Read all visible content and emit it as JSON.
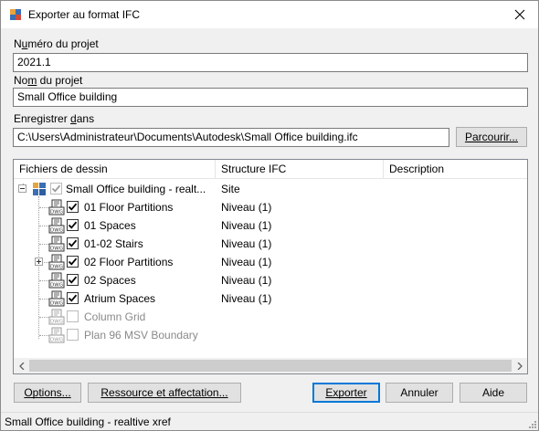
{
  "window": {
    "title": "Exporter au format IFC",
    "close_icon": "close-icon"
  },
  "project_number": {
    "label_prefix": "N",
    "label_underlined": "u",
    "label_rest": "méro du projet",
    "value": "2021.1"
  },
  "project_name": {
    "label_prefix": "No",
    "label_underlined": "m",
    "label_rest": " du projet",
    "value": "Small Office building"
  },
  "save_in": {
    "label_prefix": "Enregistrer ",
    "label_underlined": "d",
    "label_rest": "ans",
    "value": "C:\\Users\\Administrateur\\Documents\\Autodesk\\Small Office building.ifc",
    "browse_label": "Parcourir..."
  },
  "list": {
    "columns": [
      "Fichiers de dessin",
      "Structure IFC",
      "Description"
    ],
    "rows": [
      {
        "name": "Small Office building - realt...",
        "structure": "Site",
        "checked": true,
        "enabled": true,
        "icon": "project-icon"
      },
      {
        "name": "01 Floor Partitions",
        "structure": "Niveau (1)",
        "checked": true,
        "enabled": true,
        "icon": "dwg-file-icon"
      },
      {
        "name": "01 Spaces",
        "structure": "Niveau (1)",
        "checked": true,
        "enabled": true,
        "icon": "dwg-file-icon"
      },
      {
        "name": "01-02 Stairs",
        "structure": "Niveau (1)",
        "checked": true,
        "enabled": true,
        "icon": "dwg-file-icon"
      },
      {
        "name": "02 Floor Partitions",
        "structure": "Niveau (1)",
        "checked": true,
        "enabled": true,
        "icon": "dwg-file-icon"
      },
      {
        "name": "02 Spaces",
        "structure": "Niveau (1)",
        "checked": true,
        "enabled": true,
        "icon": "dwg-file-icon"
      },
      {
        "name": "Atrium Spaces",
        "structure": "Niveau (1)",
        "checked": true,
        "enabled": true,
        "icon": "dwg-file-icon"
      },
      {
        "name": "Column Grid",
        "structure": "",
        "checked": false,
        "enabled": false,
        "icon": "dwg-file-icon"
      },
      {
        "name": "Plan 96 MSV Boundary",
        "structure": "",
        "checked": false,
        "enabled": false,
        "icon": "dwg-file-icon"
      }
    ]
  },
  "buttons": {
    "options": "Options...",
    "resources": "Ressource et affectation...",
    "export": "Exporter",
    "cancel": "Annuler",
    "help": "Aide"
  },
  "status": {
    "text": "Small Office building - realtive xref"
  }
}
